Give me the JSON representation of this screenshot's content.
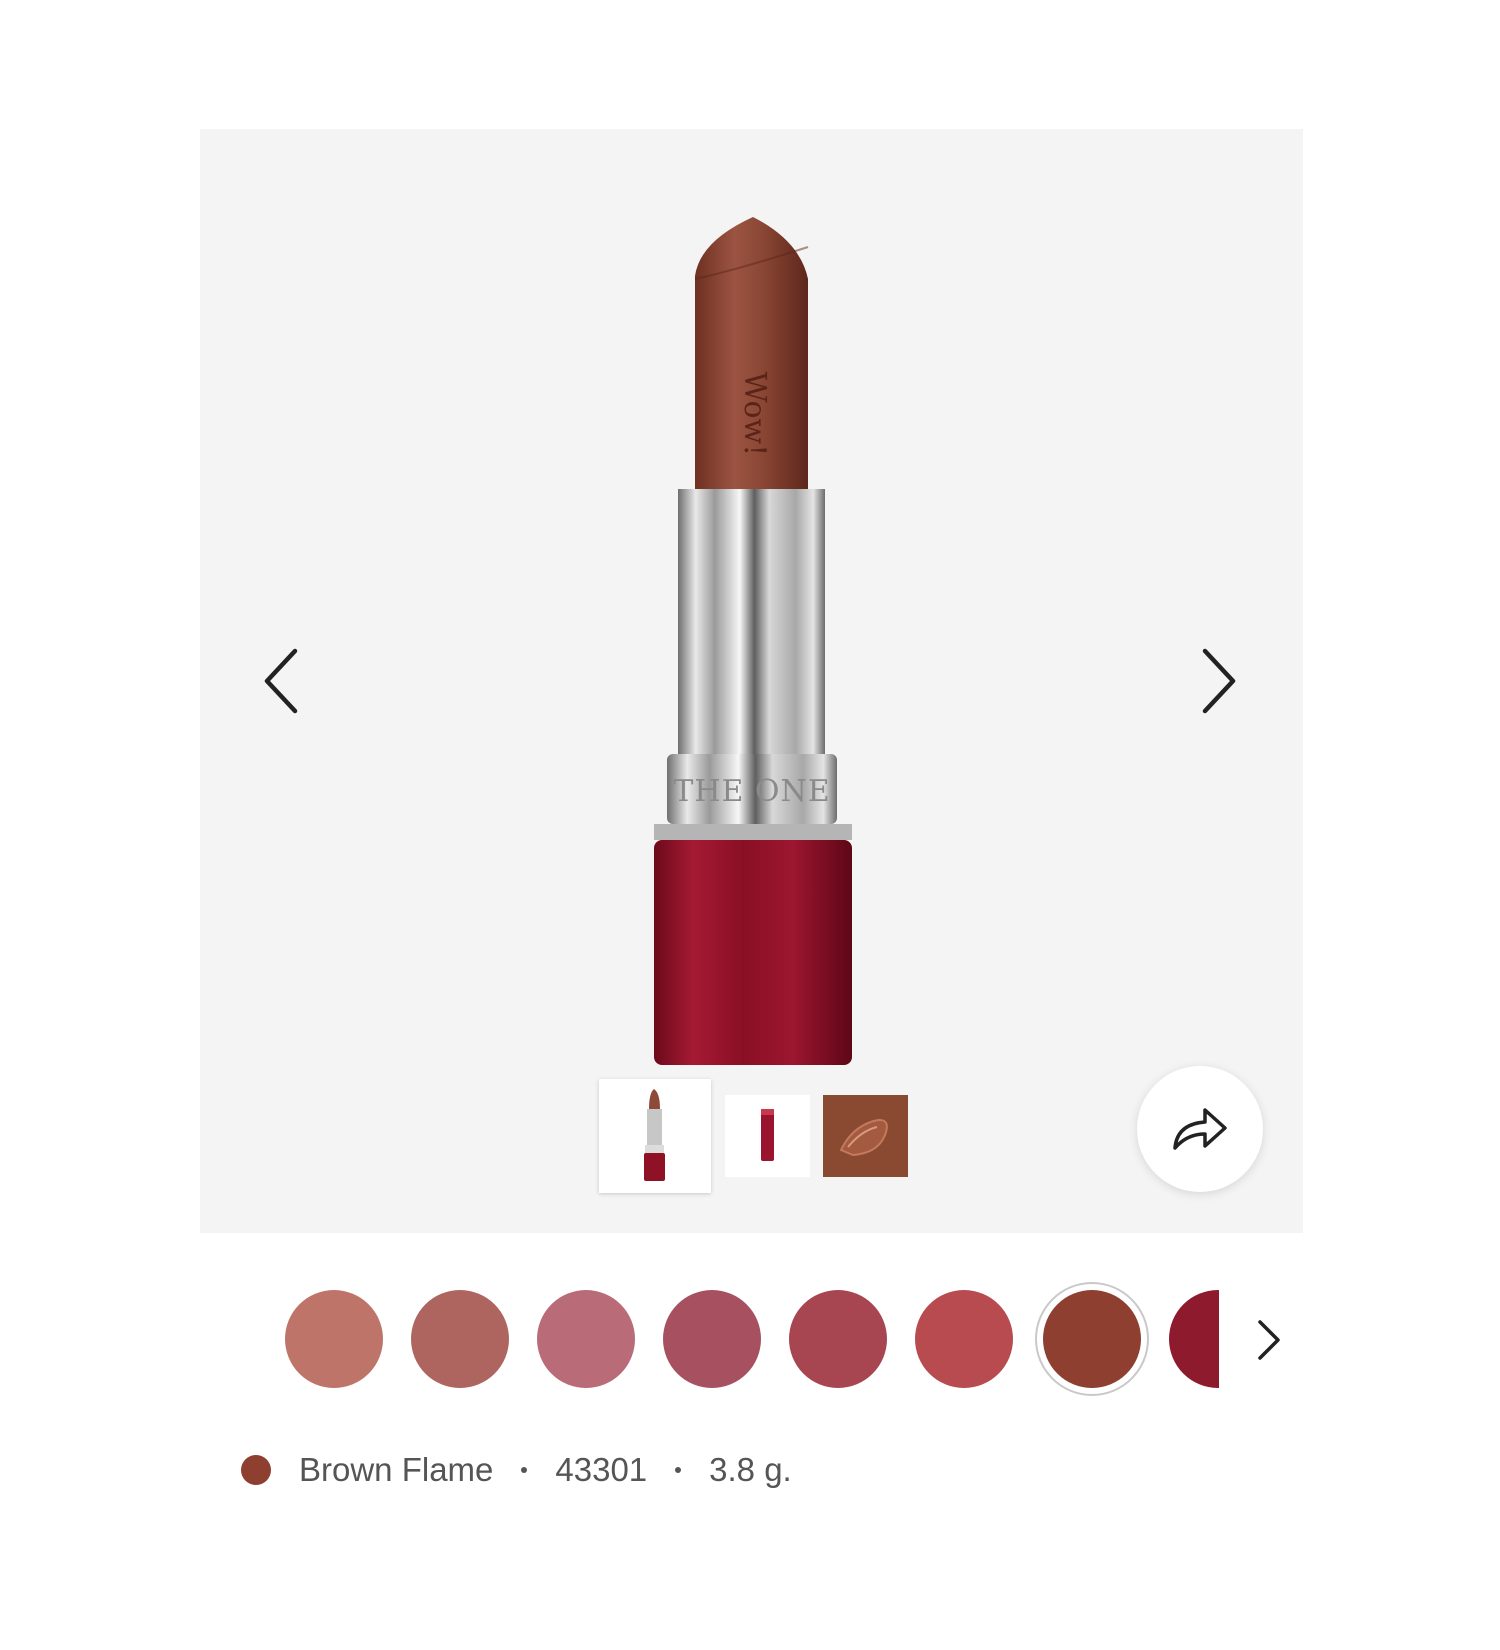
{
  "product": {
    "shade_name": "Brown Flame",
    "code": "43301",
    "size": "3.8 g.",
    "shade_color": "#8e3f30",
    "hero_image": "lipstick-product-photo",
    "bullet_text": "THE ONE",
    "bullet_logo_text": "Wow!"
  },
  "gallery": {
    "prev_icon": "chevron-left-icon",
    "next_icon": "chevron-right-icon",
    "share_icon": "share-arrow-icon",
    "thumbnails": [
      {
        "name": "thumb-lipstick-open",
        "selected": true
      },
      {
        "name": "thumb-lipstick-closed",
        "selected": false
      },
      {
        "name": "thumb-texture-swatch",
        "selected": false
      }
    ]
  },
  "swatches": {
    "colors": [
      "#bf746a",
      "#ae6560",
      "#b96b78",
      "#a75160",
      "#a74650",
      "#b74b4f",
      "#8e3f30",
      "#8e1a2d"
    ],
    "selected_index": 6,
    "next_icon": "chevron-right-icon"
  },
  "colors": {
    "gallery_bg": "#f4f4f4",
    "text": "#555555",
    "case_red": "#8e1126",
    "bullet_brown": "#8a4a38"
  }
}
